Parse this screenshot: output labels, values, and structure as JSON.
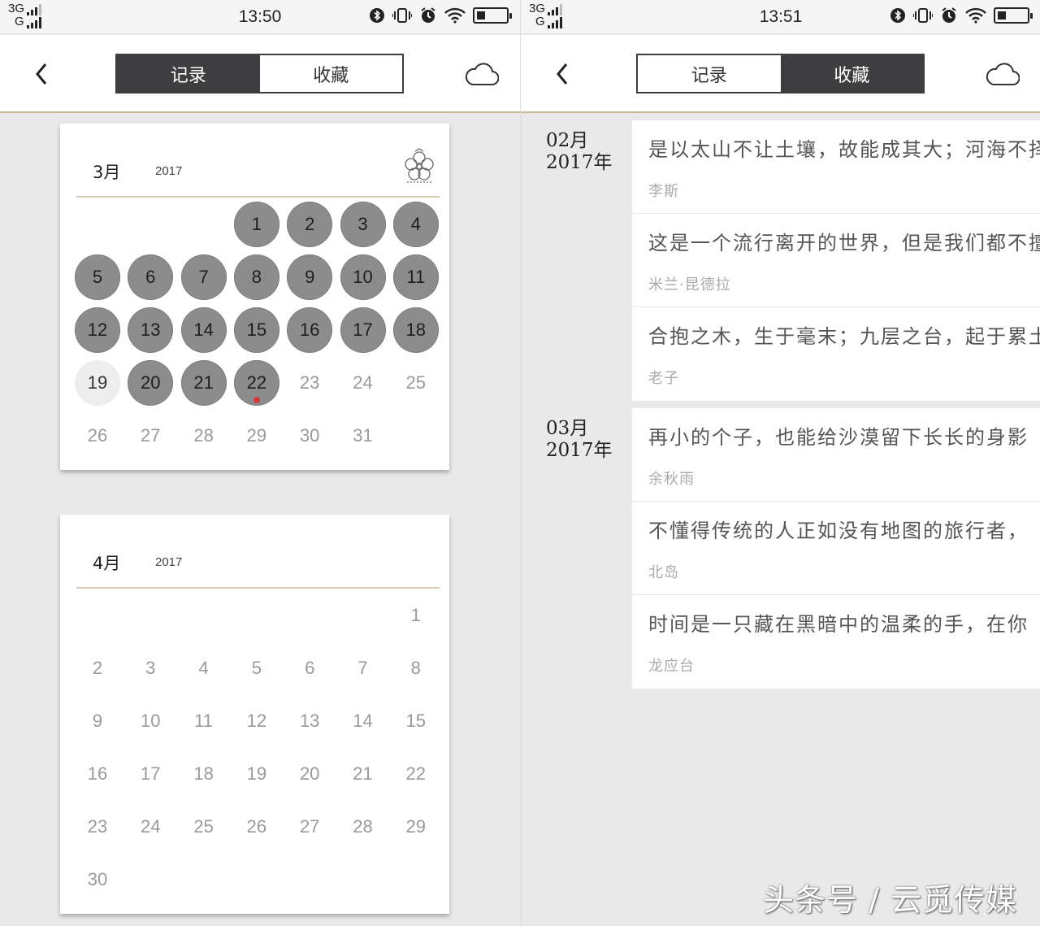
{
  "left": {
    "status": {
      "network_top": "3G",
      "network_bottom": "G",
      "time": "13:50"
    },
    "tabs": {
      "record": "记录",
      "favorites": "收藏",
      "active": "record"
    },
    "calendars": [
      {
        "month": "3月",
        "year": "2017",
        "first_weekday": 3,
        "days_in_month": 31,
        "recorded_days": [
          1,
          2,
          3,
          4,
          5,
          6,
          7,
          8,
          9,
          10,
          11,
          12,
          13,
          14,
          15,
          16,
          17,
          18,
          20,
          21,
          22
        ],
        "today": 19,
        "marked_day": 22
      },
      {
        "month": "4月",
        "year": "2017",
        "first_weekday": 6,
        "days_in_month": 30,
        "recorded_days": [],
        "today": null,
        "marked_day": null
      }
    ]
  },
  "right": {
    "status": {
      "network_top": "3G",
      "network_bottom": "G",
      "time": "13:51"
    },
    "tabs": {
      "record": "记录",
      "favorites": "收藏",
      "active": "favorites"
    },
    "groups": [
      {
        "month": "02月",
        "year": "2017年",
        "quotes": [
          {
            "text": "是以太山不让土壤，故能成其大；河海不择细流，故能就其深",
            "author": "李斯"
          },
          {
            "text": "这是一个流行离开的世界，但是我们都不擅长告别",
            "author": "米兰·昆德拉"
          },
          {
            "text": "合抱之木，生于毫末；九层之台，起于累土",
            "author": "老子"
          }
        ]
      },
      {
        "month": "03月",
        "year": "2017年",
        "quotes": [
          {
            "text": "再小的个子，也能给沙漠留下长长的身影",
            "author": "余秋雨"
          },
          {
            "text": "不懂得传统的人正如没有地图的旅行者，",
            "author": "北岛"
          },
          {
            "text": "时间是一只藏在黑暗中的温柔的手，在你",
            "author": "龙应台"
          }
        ]
      }
    ]
  },
  "watermark": "头条号 / 云觅传媒",
  "colors": {
    "accent_line": "#c9b79a",
    "tab_active": "#3e3d3f",
    "recorded_day": "#8c8c8c",
    "marker_dot": "#d23a3a"
  },
  "icons": [
    "back-arrow-icon",
    "cloud-icon",
    "flower-icon",
    "bluetooth-icon",
    "vibrate-icon",
    "alarm-icon",
    "wifi-icon",
    "battery-icon",
    "signal-icon"
  ]
}
